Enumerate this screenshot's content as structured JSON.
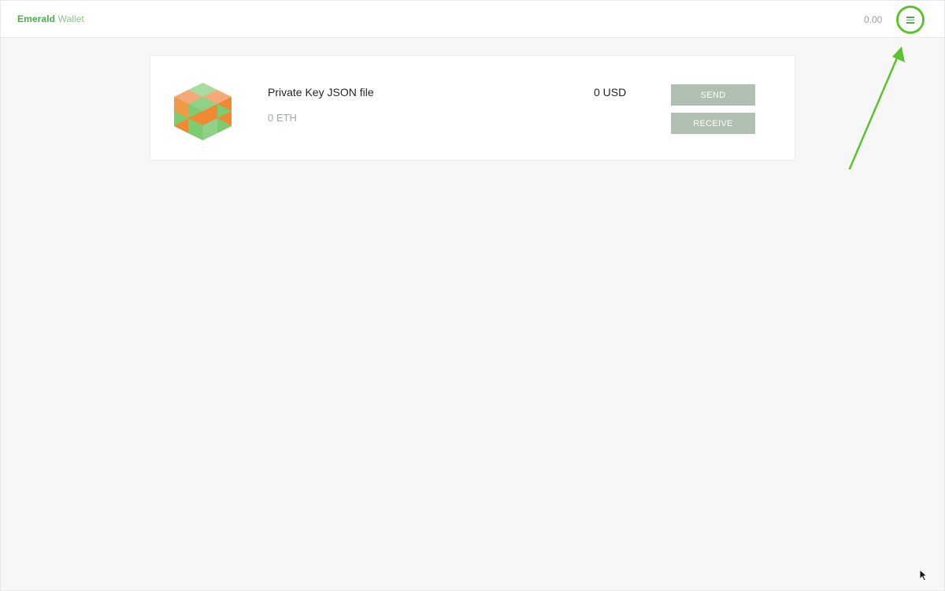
{
  "header": {
    "brand_primary": "Emerald",
    "brand_secondary": "Wallet",
    "total_balance": "0.00",
    "menu_icon": "hamburger-menu-icon"
  },
  "account": {
    "name": "Private Key JSON file",
    "eth_balance": "0 ETH",
    "usd_balance": "0 USD",
    "send_label": "SEND",
    "receive_label": "RECEIVE",
    "avatar_icon": "identicon-cube"
  },
  "colors": {
    "brand_green": "#47b04b",
    "highlight_green": "#5cc32e",
    "button_gray": "#afbfb2",
    "identicon_orange": "#f08a32",
    "identicon_green": "#7ccd72"
  }
}
